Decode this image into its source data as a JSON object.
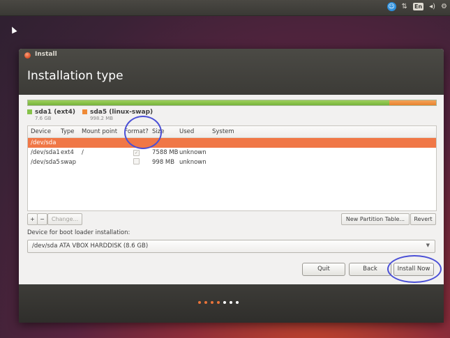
{
  "window": {
    "title": "Install",
    "page_title": "Installation type"
  },
  "usage_bar": {
    "segments": [
      {
        "name": "sda1",
        "fraction": 0.886,
        "color": "#86c24a"
      },
      {
        "name": "sda5",
        "fraction": 0.114,
        "color": "#ef8a36"
      }
    ]
  },
  "legend": [
    {
      "name": "sda1 (ext4)",
      "size": "7.6 GB",
      "color": "#86c24a"
    },
    {
      "name": "sda5 (linux-swap)",
      "size": "998.2 MB",
      "color": "#ef8a36"
    }
  ],
  "table": {
    "columns": [
      "Device",
      "Type",
      "Mount point",
      "Format?",
      "Size",
      "Used",
      "System"
    ],
    "rows": [
      {
        "device": "/dev/sda",
        "type": "",
        "mount": "",
        "format": null,
        "size": "",
        "used": "",
        "system": "",
        "selected": true
      },
      {
        "device": "/dev/sda1",
        "type": "ext4",
        "mount": "/",
        "format": true,
        "size": "7588 MB",
        "used": "unknown",
        "system": "",
        "selected": false
      },
      {
        "device": "/dev/sda5",
        "type": "swap",
        "mount": "",
        "format": false,
        "size": "998 MB",
        "used": "unknown",
        "system": "",
        "selected": false
      }
    ]
  },
  "toolbar": {
    "add": "+",
    "remove": "−",
    "change": "Change...",
    "new_table": "New Partition Table...",
    "revert": "Revert"
  },
  "boot_loader": {
    "label": "Device for boot loader installation:",
    "value": "/dev/sda   ATA VBOX HARDDISK (8.6 GB)"
  },
  "actions": {
    "quit": "Quit",
    "back": "Back",
    "install": "Install Now"
  },
  "progress": {
    "total_steps": 7,
    "completed_steps": 4,
    "done_color": "#e9743a",
    "todo_color": "#ffffff"
  },
  "tray": {
    "keyboard": "En"
  },
  "colors": {
    "selection": "#f07746",
    "annotation": "#4a4fd6"
  }
}
